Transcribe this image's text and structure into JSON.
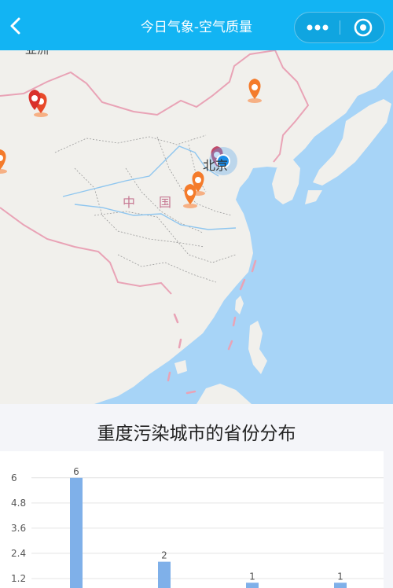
{
  "navbar": {
    "title": "今日气象-空气质量",
    "back_icon": "chevron-left-icon",
    "more_icon": "more-dots-icon",
    "close_icon": "target-circle-icon",
    "color": "#12b4f3"
  },
  "map": {
    "labels": {
      "asia": "亚洲",
      "country_zhong": "中",
      "country_guo": "国",
      "beijing": "北京"
    },
    "marker_icon": "location-pin-icon",
    "current_location_icon": "current-location-dot-icon",
    "colors": {
      "water": "#a7d4f7",
      "land": "#f1f0ec",
      "border": "#e9a3b6",
      "marker": "#f47b2b"
    }
  },
  "chart_section": {
    "title": "重度污染城市的省份分布"
  },
  "chart_data": {
    "type": "bar",
    "title": "重度污染城市的省份分布",
    "categories": [
      "",
      "",
      "",
      ""
    ],
    "values": [
      6,
      2,
      1,
      1
    ],
    "data_labels": [
      "6",
      "2",
      "1",
      "1"
    ],
    "y_ticks": [
      "1.2",
      "2.4",
      "3.6",
      "4.8",
      "6"
    ],
    "ylim": [
      0,
      6
    ],
    "grid": true,
    "bar_color": "#7fb0e9"
  }
}
